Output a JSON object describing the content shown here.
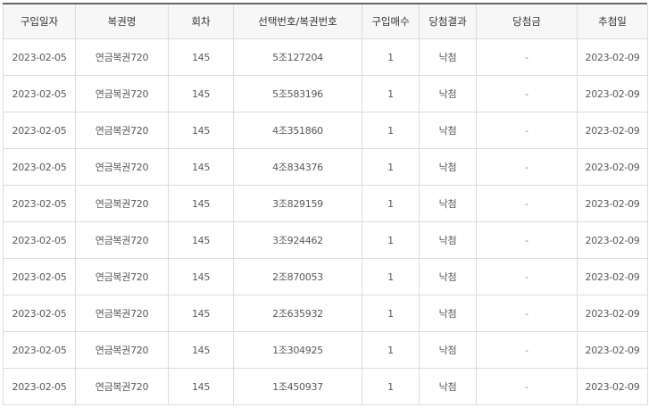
{
  "table": {
    "headers": [
      "구입일자",
      "복권명",
      "회차",
      "선택번호/복권번호",
      "구입매수",
      "당첨결과",
      "당첨금",
      "추첨일"
    ],
    "rows": [
      [
        "2023-02-05",
        "연금복권720",
        "145",
        "5조127204",
        "1",
        "낙첨",
        "-",
        "2023-02-09"
      ],
      [
        "2023-02-05",
        "연금복권720",
        "145",
        "5조583196",
        "1",
        "낙첨",
        "-",
        "2023-02-09"
      ],
      [
        "2023-02-05",
        "연금복권720",
        "145",
        "4조351860",
        "1",
        "낙첨",
        "-",
        "2023-02-09"
      ],
      [
        "2023-02-05",
        "연금복권720",
        "145",
        "4조834376",
        "1",
        "낙첨",
        "-",
        "2023-02-09"
      ],
      [
        "2023-02-05",
        "연금복권720",
        "145",
        "3조829159",
        "1",
        "낙첨",
        "-",
        "2023-02-09"
      ],
      [
        "2023-02-05",
        "연금복권720",
        "145",
        "3조924462",
        "1",
        "낙첨",
        "-",
        "2023-02-09"
      ],
      [
        "2023-02-05",
        "연금복권720",
        "145",
        "2조870053",
        "1",
        "낙첨",
        "-",
        "2023-02-09"
      ],
      [
        "2023-02-05",
        "연금복권720",
        "145",
        "2조635932",
        "1",
        "낙첨",
        "-",
        "2023-02-09"
      ],
      [
        "2023-02-05",
        "연금복권720",
        "145",
        "1조304925",
        "1",
        "낙첨",
        "-",
        "2023-02-09"
      ],
      [
        "2023-02-05",
        "연금복권720",
        "145",
        "1조450937",
        "1",
        "낙첨",
        "-",
        "2023-02-09"
      ]
    ]
  }
}
